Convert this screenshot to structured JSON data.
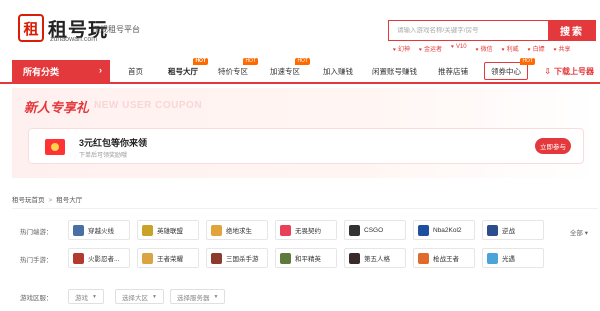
{
  "header": {
    "logo_mark": "租",
    "logo_name": "租号玩",
    "logo_domain": "zuhaowan.com",
    "platform_label": "正规租号平台",
    "search_placeholder": "请输入游戏名称/关键字/房号",
    "search_button": "搜索",
    "hot_tags": [
      "幻神",
      "金运者",
      "V10",
      "微信",
      "利威",
      "白嫖",
      "共享"
    ]
  },
  "nav": {
    "all_categories": "所有分类",
    "items": [
      "首页",
      "租号大厅",
      "特价专区",
      "加速专区",
      "加入赚钱",
      "闲置账号赚钱",
      "推荐店铺",
      "领券中心"
    ],
    "hot_badge": "HOT",
    "right_link": "下载上号器"
  },
  "banner": {
    "title": "新人专享礼",
    "ghost_text": "NEW USER COUPON",
    "coupon_title": "3元红包等你来领",
    "coupon_sub": "下单后可领奖励哦",
    "coupon_button": "立即参与"
  },
  "breadcrumb": [
    "租号玩首页",
    "租号大厅"
  ],
  "filters": {
    "pc_label": "热门端游：",
    "pc_games": [
      {
        "name": "穿越火线",
        "color": "#4a6fa5",
        "icon": "cf-icon"
      },
      {
        "name": "英雄联盟",
        "color": "#c9a227",
        "icon": "lol-icon"
      },
      {
        "name": "绝地求生",
        "color": "#e0a43a",
        "icon": "pubg-icon"
      },
      {
        "name": "无畏契约",
        "color": "#e84057",
        "icon": "valorant-icon"
      },
      {
        "name": "CSGO",
        "color": "#333333",
        "icon": "csgo-icon"
      },
      {
        "name": "Nba2Kol2",
        "color": "#1e4fa0",
        "icon": "nba-icon"
      },
      {
        "name": "逆战",
        "color": "#2b4d8c",
        "icon": "nz-icon"
      }
    ],
    "all_toggle": "全部 ▾",
    "mobile_label": "热门手游：",
    "mobile_games": [
      {
        "name": "火影忍者...",
        "color": "#b23a2e",
        "icon": "naruto-icon"
      },
      {
        "name": "王者荣耀",
        "color": "#d9a441",
        "icon": "wzry-icon"
      },
      {
        "name": "三国杀手游",
        "color": "#8b3a2b",
        "icon": "sgs-icon"
      },
      {
        "name": "和平精英",
        "color": "#5d7a3a",
        "icon": "hpjy-icon"
      },
      {
        "name": "第五人格",
        "color": "#3b2a2a",
        "icon": "id5-icon"
      },
      {
        "name": "枪战王者",
        "color": "#e06a2b",
        "icon": "qzwz-icon"
      },
      {
        "name": "光遇",
        "color": "#4aa3d9",
        "icon": "sky-icon"
      }
    ],
    "region_label": "游戏区服：",
    "dropdowns": [
      "游戏",
      "选择大区",
      "选择服务器"
    ]
  }
}
